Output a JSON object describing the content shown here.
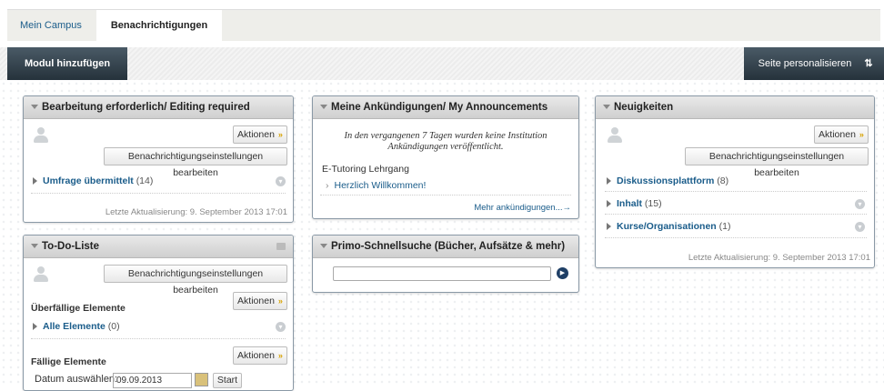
{
  "tabs": {
    "mein_campus": "Mein Campus",
    "benachrichtigungen": "Benachrichtigungen"
  },
  "toolbar": {
    "add_module": "Modul hinzufügen",
    "personalize": "Seite personalisieren",
    "sort_icon": "⇅"
  },
  "common": {
    "actions": "Aktionen",
    "notif_settings": "Benachrichtigungseinstellungen bearbeiten",
    "last_update": "Letzte Aktualisierung: 9. September 2013 17:01"
  },
  "module_editing": {
    "title": "Bearbeitung erforderlich/ Editing required",
    "item_label": "Umfrage übermittelt",
    "item_count": "(14)"
  },
  "module_todo": {
    "title": "To-Do-Liste",
    "overdue_title": "Überfällige Elemente",
    "all_label": "Alle Elemente",
    "all_count": "(0)",
    "due_title": "Fällige Elemente",
    "date_label": "Datum auswählen:",
    "date_value": "09.09.2013",
    "start": "Start"
  },
  "module_announcements": {
    "title": "Meine Ankündigungen/ My Announcements",
    "note": "In den vergangenen 7 Tagen wurden keine Institution Ankündigungen veröffentlicht.",
    "course": "E-Tutoring Lehrgang",
    "item": "Herzlich Willkommen!",
    "more": "Mehr ankündigungen...→"
  },
  "module_primo": {
    "title": "Primo-Schnellsuche (Bücher, Aufsätze & mehr)",
    "search_value": ""
  },
  "module_news": {
    "title": "Neuigkeiten",
    "items": [
      {
        "label": "Diskussionsplattform",
        "count": "(8)"
      },
      {
        "label": "Inhalt",
        "count": "(15)"
      },
      {
        "label": "Kurse/Organisationen",
        "count": "(1)"
      }
    ]
  }
}
